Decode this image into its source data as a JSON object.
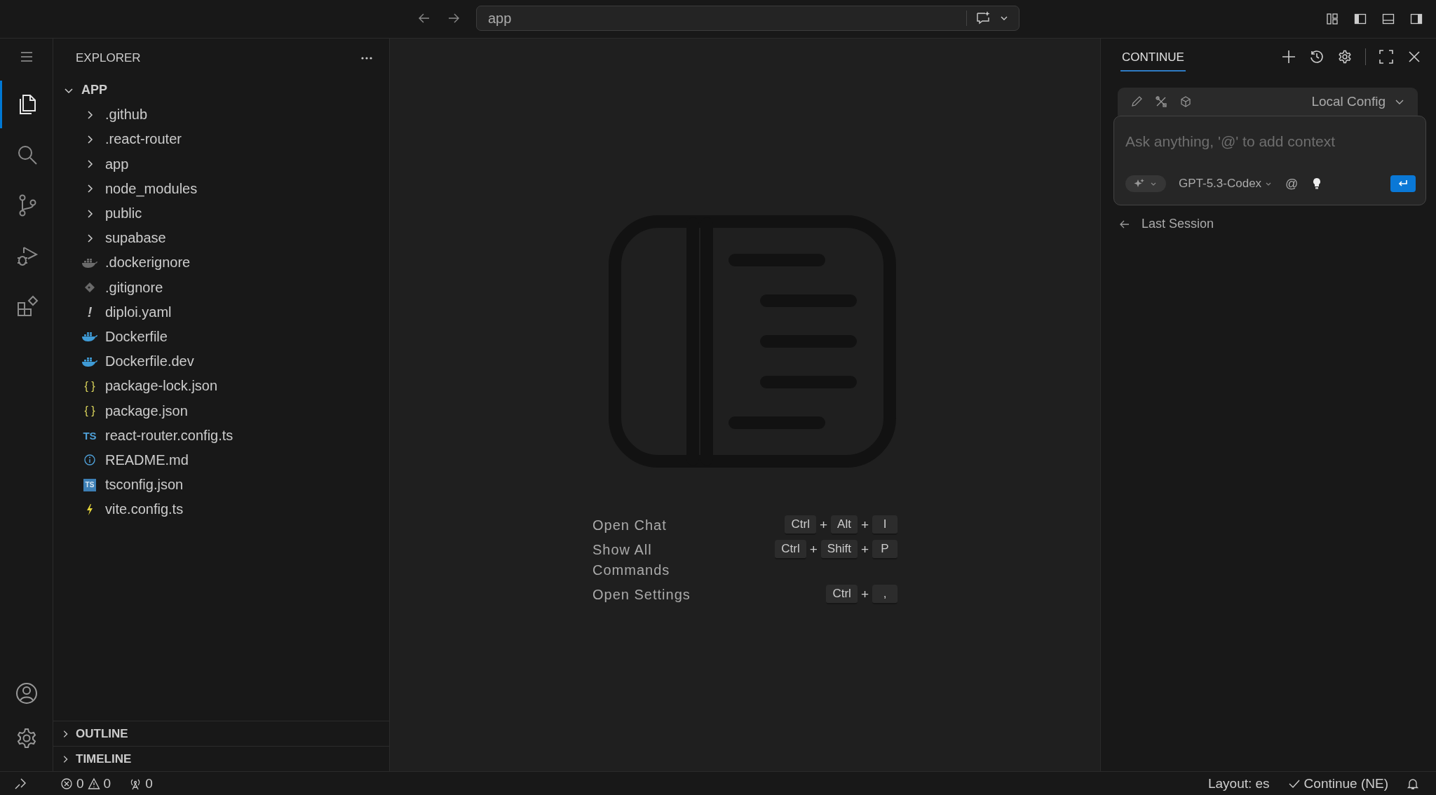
{
  "title_bar": {
    "search": {
      "value": "app"
    }
  },
  "activity_bar": {
    "items": [
      {
        "kind": "files",
        "selected": true
      },
      {
        "kind": "search",
        "selected": false
      },
      {
        "kind": "source-control",
        "selected": false
      },
      {
        "kind": "run-debug",
        "selected": false
      },
      {
        "kind": "extensions",
        "selected": false
      }
    ]
  },
  "explorer": {
    "title": "EXPLORER",
    "root": {
      "label": "APP",
      "expanded": true,
      "children": [
        {
          "kind": "folder",
          "label": ".github",
          "expanded": false
        },
        {
          "kind": "folder",
          "label": ".react-router",
          "expanded": false
        },
        {
          "kind": "folder",
          "label": "app",
          "expanded": false
        },
        {
          "kind": "folder",
          "label": "node_modules",
          "expanded": false
        },
        {
          "kind": "folder",
          "label": "public",
          "expanded": false
        },
        {
          "kind": "folder",
          "label": "supabase",
          "expanded": false
        },
        {
          "kind": "dockerignore",
          "label": ".dockerignore"
        },
        {
          "kind": "git",
          "label": ".gitignore"
        },
        {
          "kind": "yaml",
          "label": "diploi.yaml",
          "glyph": "!"
        },
        {
          "kind": "docker",
          "label": "Dockerfile"
        },
        {
          "kind": "docker",
          "label": "Dockerfile.dev"
        },
        {
          "kind": "json",
          "label": "package-lock.json",
          "glyph": "{ }"
        },
        {
          "kind": "json",
          "label": "package.json",
          "glyph": "{ }"
        },
        {
          "kind": "ts",
          "label": "react-router.config.ts",
          "glyph": "TS"
        },
        {
          "kind": "info",
          "label": "README.md"
        },
        {
          "kind": "tsconfig",
          "label": "tsconfig.json",
          "glyph": "TS"
        },
        {
          "kind": "vite",
          "label": "vite.config.ts"
        }
      ]
    },
    "sections": [
      {
        "label": "OUTLINE",
        "expanded": false
      },
      {
        "label": "TIMELINE",
        "expanded": false
      }
    ]
  },
  "editor": {
    "shortcuts": [
      {
        "label": "Open Chat",
        "keys": [
          "Ctrl",
          "Alt",
          "I"
        ],
        "joiner": "+"
      },
      {
        "label": "Show All Commands",
        "keys": [
          "Ctrl",
          "Shift",
          "P"
        ],
        "joiner": "+"
      },
      {
        "label": "Open Settings",
        "keys": [
          "Ctrl",
          ","
        ],
        "joiner": "+"
      }
    ]
  },
  "continue_panel": {
    "tabs": [
      {
        "label": "CONTINUE",
        "selected": true
      }
    ],
    "config": {
      "label": "Local Config"
    },
    "input": {
      "placeholder": "Ask anything, '@' to add context"
    },
    "model": "GPT-5.3-Codex",
    "mention": "@",
    "last_session": "Last Session"
  },
  "status_bar": {
    "errors": "0",
    "warnings": "0",
    "ports": "0",
    "layout": "Layout: es",
    "extension": "Continue (NE)"
  }
}
